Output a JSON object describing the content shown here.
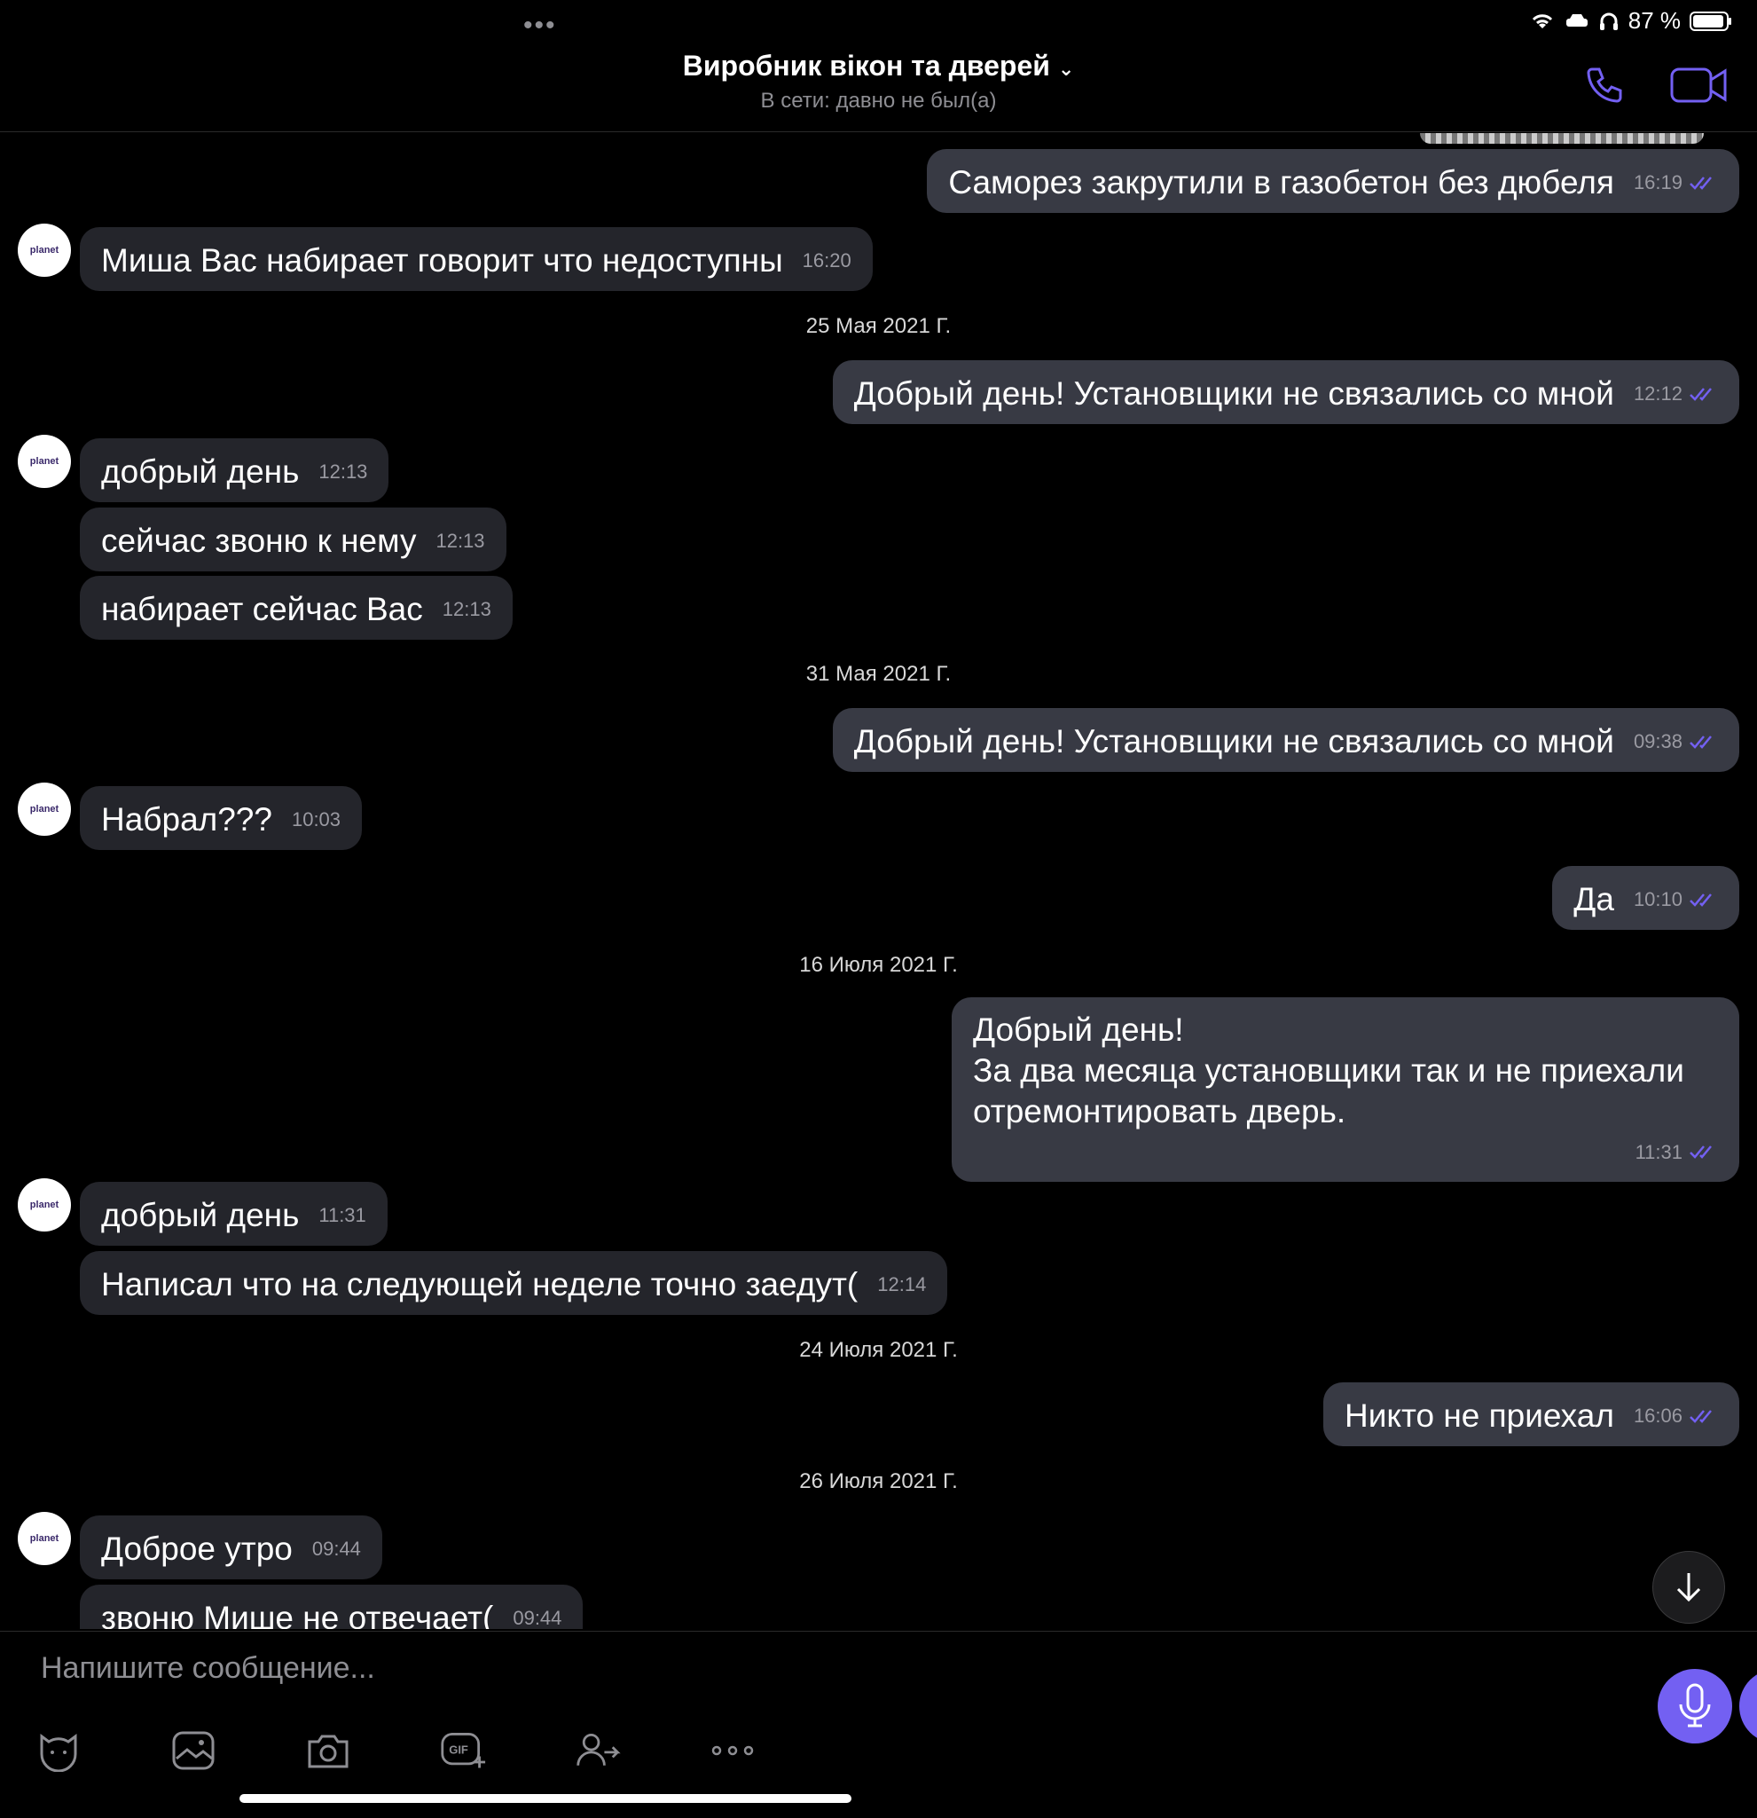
{
  "status_bar": {
    "battery_text": "87 %"
  },
  "header": {
    "title": "Виробник вікон та дверей",
    "subtitle": "В сети: давно не был(а)"
  },
  "messages": [
    {
      "dir": "out",
      "text": "Саморез закрутили в газобетон без дюбеля",
      "time": "16:19"
    },
    {
      "dir": "in",
      "text": "Миша Вас набирает говорит что недоступны",
      "time": "16:20"
    },
    {
      "dir": "out",
      "text": "Добрый день! Установщики не связались со мной",
      "time": "12:12"
    },
    {
      "dir": "in",
      "text": "добрый день",
      "time": "12:13"
    },
    {
      "dir": "in",
      "text": "сейчас звоню к нему",
      "time": "12:13"
    },
    {
      "dir": "in",
      "text": "набирает сейчас Вас",
      "time": "12:13"
    },
    {
      "dir": "out",
      "text": "Добрый день! Установщики не связались со мной",
      "time": "09:38"
    },
    {
      "dir": "in",
      "text": "Набрал???",
      "time": "10:03"
    },
    {
      "dir": "out",
      "text": "Да",
      "time": "10:10"
    },
    {
      "dir": "out",
      "lines": [
        "Добрый день!",
        "За два месяца установщики так и не приехали",
        "отремонтировать дверь."
      ],
      "time": "11:31"
    },
    {
      "dir": "in",
      "text": "добрый день",
      "time": "11:31"
    },
    {
      "dir": "in",
      "text": "Написал что на следующей неделе точно заедут(",
      "time": "12:14"
    },
    {
      "dir": "out",
      "text": "Никто не приехал",
      "time": "16:06"
    },
    {
      "dir": "in",
      "text": "Доброе утро",
      "time": "09:44"
    },
    {
      "dir": "in",
      "text": "звоню Мише не отвечает(",
      "time": "09:44"
    }
  ],
  "dates": [
    "25 Мая 2021 Г.",
    "31 Мая 2021 Г.",
    "16 Июля 2021 Г.",
    "24 Июля 2021 Г.",
    "26 Июля 2021 Г."
  ],
  "avatar_label": "planet",
  "composer": {
    "placeholder": "Напишите сообщение...",
    "gif_label": "GIF"
  },
  "colors": {
    "accent": "#7360f2",
    "bubble_out": "#383a44",
    "bubble_in": "#24252b",
    "background": "#000000"
  },
  "icons": [
    "wifi-icon",
    "car-icon",
    "headphones-icon",
    "battery-icon",
    "phone-icon",
    "video-icon",
    "sticker-icon",
    "gallery-icon",
    "camera-icon",
    "gif-icon",
    "share-contact-icon",
    "more-icon",
    "mic-icon",
    "arrow-down-icon"
  ]
}
